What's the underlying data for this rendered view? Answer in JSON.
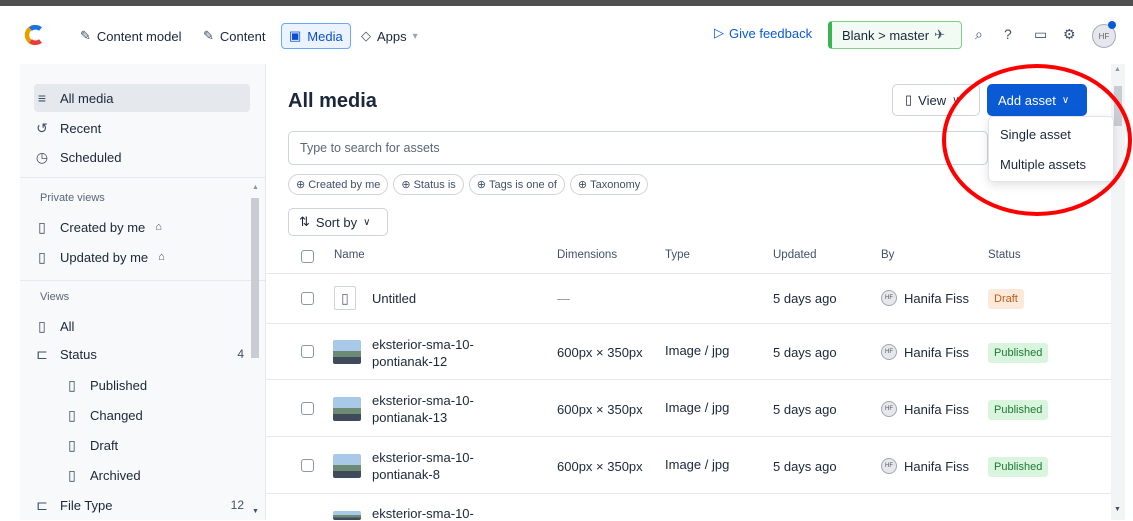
{
  "nav": {
    "items": [
      {
        "label": "Content model",
        "icon": "pen-nib-icon"
      },
      {
        "label": "Content",
        "icon": "feather-icon"
      },
      {
        "label": "Media",
        "icon": "image-icon"
      },
      {
        "label": "Apps",
        "icon": "apps-icon"
      }
    ],
    "feedback": "Give feedback",
    "environment": "Blank > master",
    "avatar_initials": "HF"
  },
  "sidebar": {
    "top": [
      {
        "label": "All media",
        "icon": "list-icon"
      },
      {
        "label": "Recent",
        "icon": "history-icon"
      },
      {
        "label": "Scheduled",
        "icon": "clock-icon"
      }
    ],
    "private_views_heading": "Private views",
    "private_views": [
      {
        "label": "Created by me",
        "icon": "bookmark-icon"
      },
      {
        "label": "Updated by me",
        "icon": "bookmark-icon"
      }
    ],
    "views_heading": "Views",
    "views": [
      {
        "label": "All",
        "count": ""
      },
      {
        "label": "Status",
        "count": "4"
      },
      {
        "label": "Published",
        "count": ""
      },
      {
        "label": "Changed",
        "count": ""
      },
      {
        "label": "Draft",
        "count": ""
      },
      {
        "label": "Archived",
        "count": ""
      },
      {
        "label": "File Type",
        "count": "12"
      }
    ]
  },
  "main": {
    "title": "All media",
    "view_label": "View",
    "add_asset_label": "Add asset",
    "search_placeholder": "Type to search for assets",
    "filters": [
      "Created by me",
      "Status is",
      "Tags is one of",
      "Taxonomy"
    ],
    "sort_label": "Sort by",
    "dropdown": [
      "Single asset",
      "Multiple assets"
    ]
  },
  "table": {
    "columns": [
      "Name",
      "Dimensions",
      "Type",
      "Updated",
      "By",
      "Status"
    ],
    "rows": [
      {
        "name": "Untitled",
        "dimensions": "—",
        "type": "",
        "updated": "5 days ago",
        "by": "Hanifa Fiss",
        "status": "Draft"
      },
      {
        "name": "eksterior-sma-10-pontianak-12",
        "name_line1": "eksterior-sma-10-",
        "name_line2": "pontianak-12",
        "dimensions": "600px × 350px",
        "type": "Image / jpg",
        "updated": "5 days ago",
        "by": "Hanifa Fiss",
        "status": "Published"
      },
      {
        "name": "eksterior-sma-10-pontianak-13",
        "name_line1": "eksterior-sma-10-",
        "name_line2": "pontianak-13",
        "dimensions": "600px × 350px",
        "type": "Image / jpg",
        "updated": "5 days ago",
        "by": "Hanifa Fiss",
        "status": "Published"
      },
      {
        "name": "eksterior-sma-10-pontianak-8",
        "name_line1": "eksterior-sma-10-",
        "name_line2": "pontianak-8",
        "dimensions": "600px × 350px",
        "type": "Image / jpg",
        "updated": "5 days ago",
        "by": "Hanifa Fiss",
        "status": "Published"
      },
      {
        "name_line1": "eksterior-sma-10-"
      }
    ]
  },
  "colors": {
    "accent": "#0a5ad6",
    "annotation": "#ff0000"
  }
}
